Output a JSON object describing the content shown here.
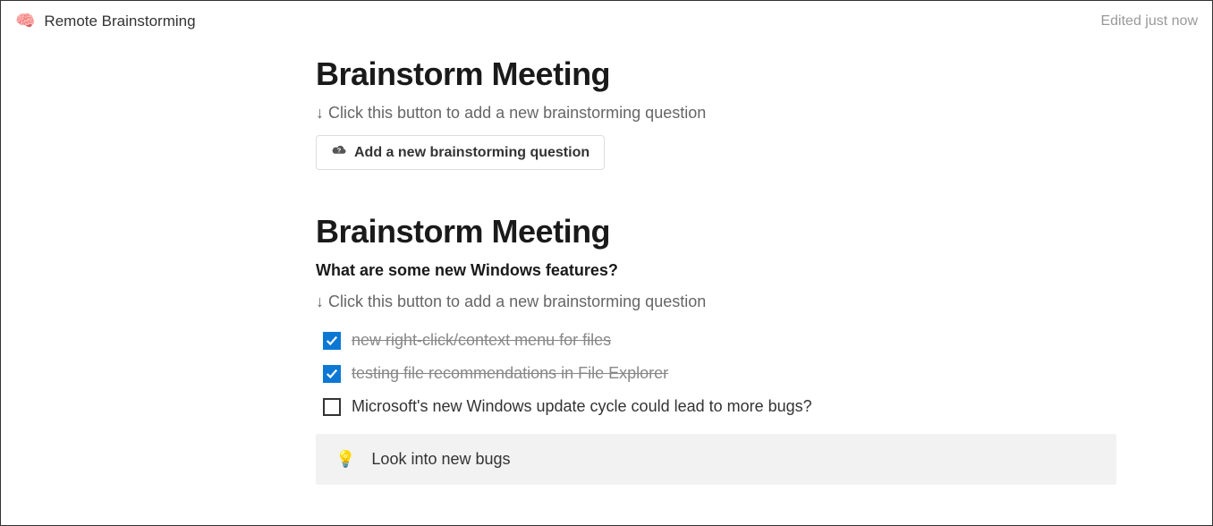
{
  "header": {
    "doc_title": "Remote Brainstorming",
    "edit_status": "Edited just now"
  },
  "section1": {
    "heading": "Brainstorm Meeting",
    "instruction": "↓ Click this button to add a new brainstorming question",
    "button_label": "Add a new brainstorming question"
  },
  "section2": {
    "heading": "Brainstorm Meeting",
    "question": "What are some new Windows features?",
    "instruction": "↓ Click this button to add a new brainstorming question",
    "items": [
      {
        "checked": true,
        "text": "new right-click/context menu for files"
      },
      {
        "checked": true,
        "text": "testing file recommendations in File Explorer"
      },
      {
        "checked": false,
        "text": "Microsoft's new Windows update cycle could lead to more bugs?"
      }
    ],
    "callout": "Look into new bugs"
  }
}
